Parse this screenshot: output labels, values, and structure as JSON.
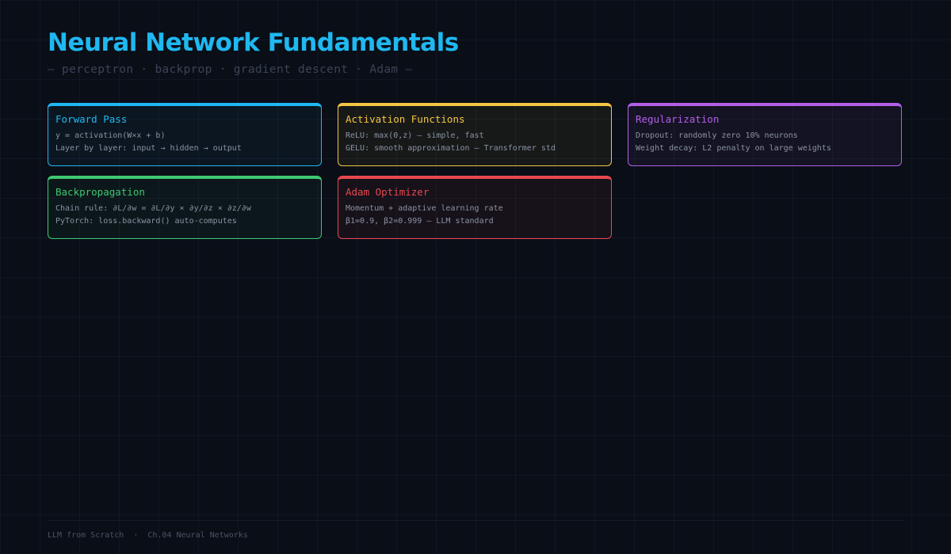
{
  "header": {
    "title": "Neural Network Fundamentals",
    "subtitle": "— perceptron · backprop · gradient descent · Adam —"
  },
  "cards": [
    {
      "title": "Forward Pass",
      "lines": [
        "y = activation(W×x + b)",
        "Layer by layer: input → hidden → output"
      ],
      "color": "#1fb8f0"
    },
    {
      "title": "Activation Functions",
      "lines": [
        "ReLU: max(0,z) — simple, fast",
        "GELU: smooth approximation — Transformer std"
      ],
      "color": "#f5c542"
    },
    {
      "title": "Regularization",
      "lines": [
        "Dropout: randomly zero 10% neurons",
        "Weight decay: L2 penalty on large weights"
      ],
      "color": "#b45ee8"
    },
    {
      "title": "Backpropagation",
      "lines": [
        "Chain rule: ∂L/∂w = ∂L/∂y × ∂y/∂z × ∂z/∂w",
        "PyTorch: loss.backward() auto-computes"
      ],
      "color": "#3ec971"
    },
    {
      "title": "Adam Optimizer",
      "lines": [
        "Momentum + adaptive learning rate",
        "β1=0.9, β2=0.999 — LLM standard"
      ],
      "color": "#e8484e"
    }
  ],
  "footer": {
    "book": "LLM from Scratch",
    "separator": "·",
    "chapter": "Ch.04 Neural Networks"
  }
}
